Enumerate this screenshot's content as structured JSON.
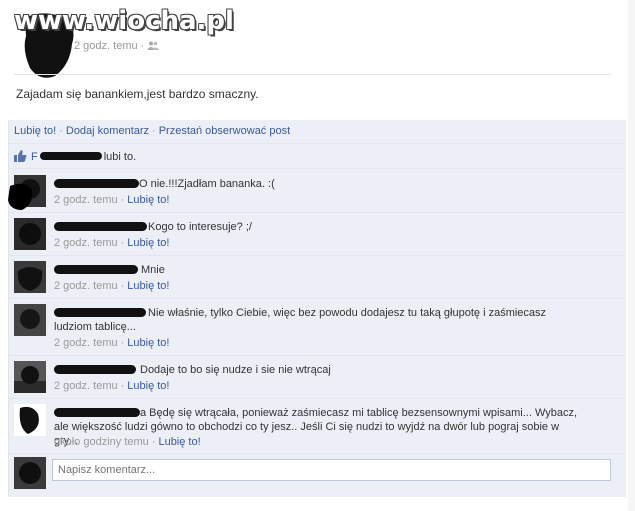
{
  "watermark": "www.wiocha.pl",
  "post": {
    "time": "2 godz. temu ·",
    "audience_icon": "friends-icon",
    "text": "Zajadam się banankiem,jest bardzo smaczny."
  },
  "actions": {
    "like": "Lubię to!",
    "comment": "Dodaj komentarz",
    "unfollow": "Przestań obserwować post"
  },
  "likes": {
    "first_letter": "F",
    "suffix": "lubi to."
  },
  "comments": [
    {
      "text": "O nie.!!!Zjadłam bananka. :(",
      "time": "2 godz. temu",
      "like": "Lubię to!"
    },
    {
      "text": "Kogo to interesuje? ;/",
      "time": "2 godz. temu",
      "like": "Lubię to!"
    },
    {
      "text": "Mnie",
      "time": "2 godz. temu",
      "like": "Lubię to!"
    },
    {
      "text": "Nie właśnie, tylko Ciebie, więc bez powodu dodajesz tu taką głupotę i zaśmiecasz ludziom tablicę...",
      "time": "2 godz. temu",
      "like": "Lubię to!"
    },
    {
      "text": "Dodaje to bo się nudze i sie nie wtrącaj",
      "time": "2 godz. temu",
      "like": "Lubię to!"
    },
    {
      "text": "a Będę się wtrącała, ponieważ zaśmiecasz mi tablicę bezsensownymi wpisami... Wybacz, ale większość ludzi gówno to obchodzi co ty jesz.. Jeśli Ci się nudzi to wyjdź na dwór lub pograj sobie w gry...",
      "time": "około godziny temu",
      "like": "Lubię to!"
    }
  ],
  "comment_input": {
    "placeholder": "Napisz komentarz..."
  },
  "colors": {
    "link": "#3b5998",
    "panel": "#eceff5",
    "muted": "#999999"
  }
}
